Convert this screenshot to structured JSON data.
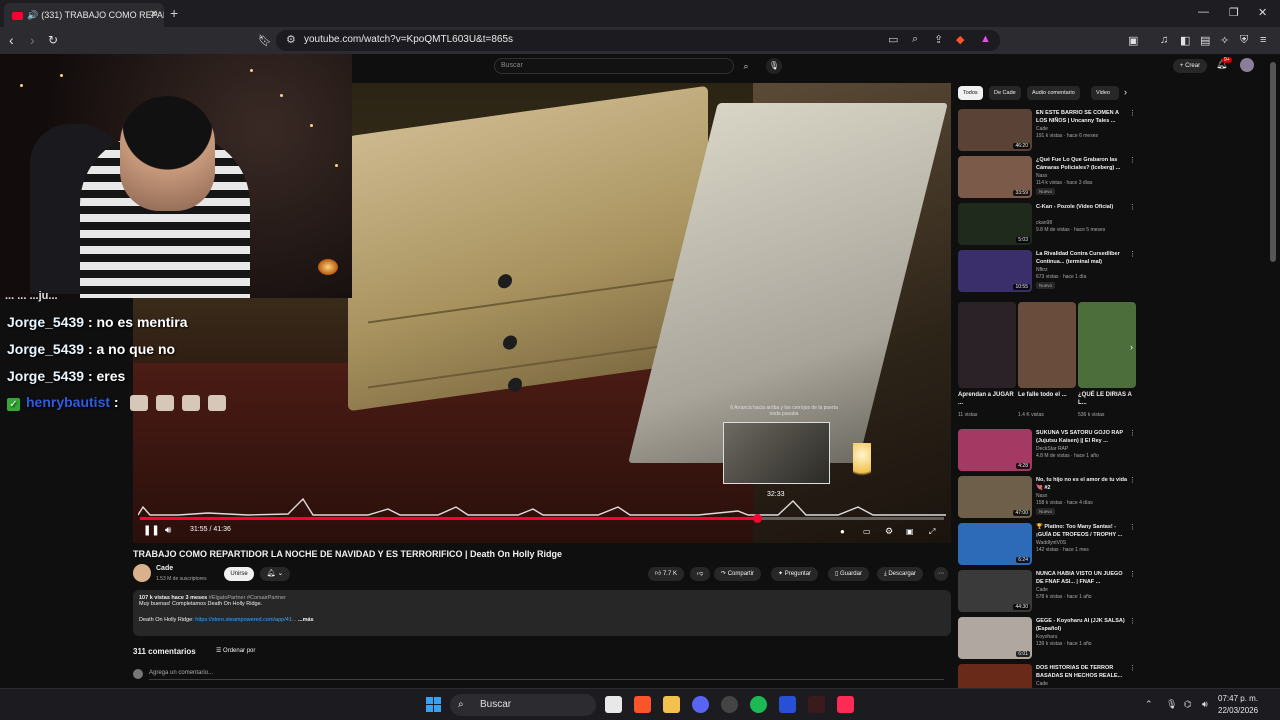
{
  "browser": {
    "tab_title": "(331) TRABAJO COMO REPAR",
    "new_tab": "+",
    "url": "youtube.com/watch?v=KpoQMTL603U&t=865s",
    "window_controls": [
      "—",
      "❐",
      "✕"
    ]
  },
  "youtube_header": {
    "search_placeholder": "Buscar",
    "create_label": "+ Crear",
    "notifications_badge": "9+"
  },
  "player": {
    "current_time": "31:55",
    "duration": "41:36",
    "timecode": "31:55 / 41:36",
    "progress_fraction": 0.767,
    "preview_time": "32:33",
    "preview_caption": "6 Arranca hacia arriba y los cerrojos de la puerta nada pasaba"
  },
  "stream_overlay": {
    "chat_partial": "... ... ...ju...",
    "messages": [
      {
        "user": "Jorge_5439",
        "text": ": no es mentira"
      },
      {
        "user": "Jorge_5439",
        "text": ": a no que no"
      },
      {
        "user": "Jorge_5439",
        "text": ": eres"
      }
    ],
    "henry_user": "henrybautist",
    "henry_sep": ":"
  },
  "video": {
    "title": "TRABAJO COMO REPARTIDOR LA NOCHE DE NAVIDAD Y ES TERRORIFICO | Death On Holly Ridge",
    "channel": "Cade",
    "subscribers": "1.53 M de suscriptores",
    "join_label": "Unirse",
    "likes": "7.7 K",
    "share_label": "Compartir",
    "ask_label": "Preguntar",
    "save_label": "Guardar",
    "download_label": "Descargar",
    "desc_stats": "107 k vistas  hace 3 meses",
    "desc_tags": "#ElgatoPartner #CorsairPartner",
    "desc_line1": "Muy buenas! Completamos Death On Holly Ridge.",
    "desc_link_label": "Death On Holly Ridge:",
    "desc_link": "https://store.steampowered.com/app/41...",
    "desc_more": "...más",
    "comments_count": "311 comentarios",
    "sort_label": "Ordenar por",
    "add_comment_placeholder": "Agrega un comentario..."
  },
  "sidebar": {
    "chips": [
      "Todos",
      "De Cade",
      "Audio comentario",
      "Video"
    ],
    "recommendations": [
      {
        "title": "EN ESTE BARRIO SE COMEN A LOS NIÑOS | Uncanny Tales ...",
        "channel": "Cade",
        "meta": "191 k vistas · hace 6 meses",
        "duration": "46:20",
        "nuevo": "",
        "color": "#5a4236"
      },
      {
        "title": "¿Qué Fue Lo Que Grabaron las Cámaras Policiales? (Iceberg) ...",
        "channel": "Nasx",
        "meta": "114 k vistas · hace 3 días",
        "duration": "33:59",
        "nuevo": "Nuevo",
        "color": "#7c5a4a"
      },
      {
        "title": "C-Kan - Pozole (Video Oficial)",
        "channel": "ckan98",
        "meta": "9.8 M de vistas · hace 5 meses",
        "duration": "5:03",
        "nuevo": "",
        "color": "#1f2a1c"
      },
      {
        "title": "La Rivalidad Contra Cursedliber Continua... (terminal mal)",
        "channel": "Nfkrz",
        "meta": "673 vistas · hace 1 día",
        "duration": "10:55",
        "nuevo": "Nuevo",
        "color": "#3a2f6a"
      }
    ],
    "shorts": [
      {
        "title": "Aprendan a JUGAR ...",
        "views": "11 vistas",
        "color": "#2a2226"
      },
      {
        "title": "Le falle todo el ...",
        "views": "1.4 K vistas",
        "color": "#6a4c3c"
      },
      {
        "title": "¿QUÉ LE DIRIAS A L...",
        "views": "536 k vistas",
        "color": "#4c6e3a"
      }
    ],
    "recommendations2": [
      {
        "title": "SUKUNA VS SATORU GOJO RAP (Jujutsu Kaisen) || El Rey ...",
        "channel": "DeckStar RAP",
        "meta": "4.8 M de vistas · hace 1 año",
        "duration": "4:28",
        "nuevo": "",
        "color": "#a43a64"
      },
      {
        "title": "No, tu hijo no es el amor de tu vida 💘 #2",
        "channel": "Nasx",
        "meta": "158 k vistas · hace 4 días",
        "duration": "47:00",
        "nuevo": "Nuevo",
        "color": "#6d5f4a"
      },
      {
        "title": "🏆 Platino: Too Many Santas! - ¡GUÍA DE TROFEOS / TROPHY ...",
        "channel": "WaddlyntV0S",
        "meta": "142 vistas · hace 1 mes",
        "duration": "6:24",
        "nuevo": "",
        "color": "#2d6ab8"
      },
      {
        "title": "NUNCA HABIA VISTO UN JUEGO DE FNAF ASI... | FNAF ...",
        "channel": "Cade",
        "meta": "578 k vistas · hace 1 año",
        "duration": "44:30",
        "nuevo": "",
        "color": "#3a3a3a"
      },
      {
        "title": "GEGE - Koyoharu AI (JJK SALSA)(Español)",
        "channel": "Koyoharu",
        "meta": "139 k vistas · hace 1 año",
        "duration": "6:01",
        "nuevo": "",
        "color": "#b0a8a0"
      },
      {
        "title": "DOS HISTORIAS DE TERROR BASADAS EN HECHOS REALE...",
        "channel": "Cade",
        "meta": "",
        "duration": "",
        "nuevo": "",
        "color": "#6a2a1a"
      }
    ]
  },
  "taskbar": {
    "search_label": "Buscar",
    "time": "07:47 p. m.",
    "date": "22/03/2026"
  }
}
